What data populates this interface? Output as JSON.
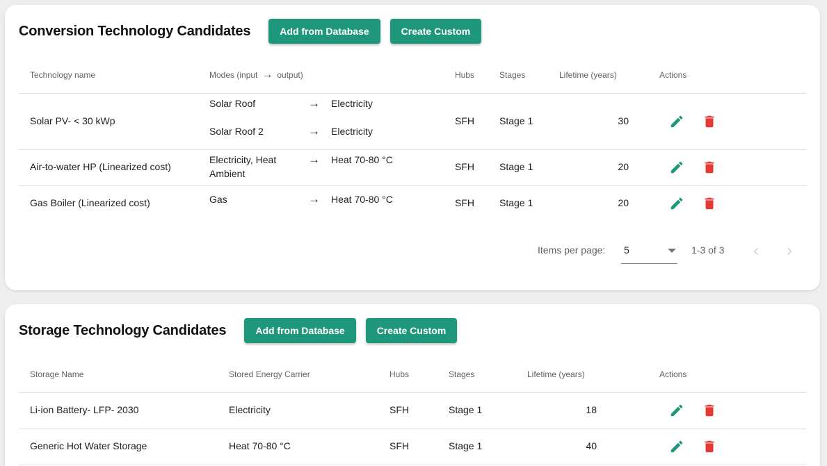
{
  "conversion": {
    "title": "Conversion Technology Candidates",
    "add_button": "Add from Database",
    "custom_button": "Create Custom",
    "headers": {
      "name": "Technology name",
      "modes_prefix": "Modes (input",
      "modes_suffix": "output)",
      "hubs": "Hubs",
      "stages": "Stages",
      "lifetime": "Lifetime (years)",
      "actions": "Actions"
    },
    "rows": [
      {
        "name": "Solar PV- < 30 kWp",
        "modes": [
          {
            "input": "Solar Roof",
            "output": "Electricity"
          },
          {
            "input": "Solar Roof 2",
            "output": "Electricity"
          }
        ],
        "hubs": "SFH",
        "stages": "Stage 1",
        "lifetime": "30"
      },
      {
        "name": "Air-to-water HP (Linearized cost)",
        "modes": [
          {
            "input_line1": "Electricity, Heat",
            "input_line2": "Ambient",
            "output": "Heat 70-80 °C"
          }
        ],
        "hubs": "SFH",
        "stages": "Stage 1",
        "lifetime": "20"
      },
      {
        "name": "Gas Boiler (Linearized cost)",
        "modes": [
          {
            "input": "Gas",
            "output": "Heat 70-80 °C"
          }
        ],
        "hubs": "SFH",
        "stages": "Stage 1",
        "lifetime": "20"
      }
    ],
    "paginator": {
      "label": "Items per page:",
      "page_size": "5",
      "range": "1-3 of 3"
    }
  },
  "storage": {
    "title": "Storage Technology Candidates",
    "add_button": "Add from Database",
    "custom_button": "Create Custom",
    "headers": {
      "name": "Storage Name",
      "carrier": "Stored Energy Carrier",
      "hubs": "Hubs",
      "stages": "Stages",
      "lifetime": "Lifetime (years)",
      "actions": "Actions"
    },
    "rows": [
      {
        "name": "Li-ion Battery- LFP- 2030",
        "carrier": "Electricity",
        "hubs": "SFH",
        "stages": "Stage 1",
        "lifetime": "18"
      },
      {
        "name": "Generic Hot Water Storage",
        "carrier": "Heat 70-80 °C",
        "hubs": "SFH",
        "stages": "Stage 1",
        "lifetime": "40"
      }
    ]
  },
  "icons": {
    "edit": "pencil-icon",
    "delete": "trash-icon",
    "arrow": "arrow-right-icon",
    "prev": "chevron-left-icon",
    "next": "chevron-right-icon",
    "dropdown": "caret-down-icon"
  },
  "colors": {
    "primary": "#1f977d",
    "edit_icon": "#1f977d",
    "delete_icon": "#e53935",
    "background": "#eeeeee"
  }
}
